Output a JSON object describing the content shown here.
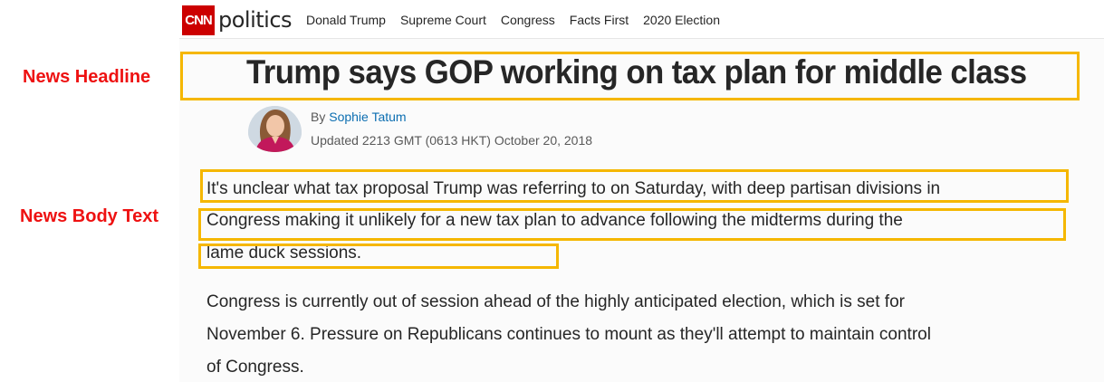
{
  "nav": {
    "logo_text": "CNN",
    "section_title": "politics",
    "links": [
      "Donald Trump",
      "Supreme Court",
      "Congress",
      "Facts First",
      "2020 Election"
    ]
  },
  "annotations": {
    "headline_label": "News Headline",
    "body_label": "News Body Text"
  },
  "article": {
    "headline": "Trump says GOP working on tax plan for middle class",
    "byline_prefix": "By",
    "author": "Sophie Tatum",
    "updated": "Updated 2213 GMT (0613 HKT) October 20, 2018",
    "paragraph1": [
      "It's unclear what tax proposal Trump was referring to on Saturday, with deep partisan divisions in",
      "Congress making it unlikely for a new tax plan to advance following the midterms during the",
      "lame duck sessions."
    ],
    "paragraph2": [
      "Congress is currently out of session ahead of the highly anticipated election, which is set for",
      "November 6. Pressure on Republicans continues to mount as they'll attempt to maintain control",
      "of Congress."
    ]
  },
  "colors": {
    "brand_red": "#cc0000",
    "annotation_red": "#ee1111",
    "annotation_box": "#f5b700",
    "link_blue": "#0c6eb1"
  }
}
